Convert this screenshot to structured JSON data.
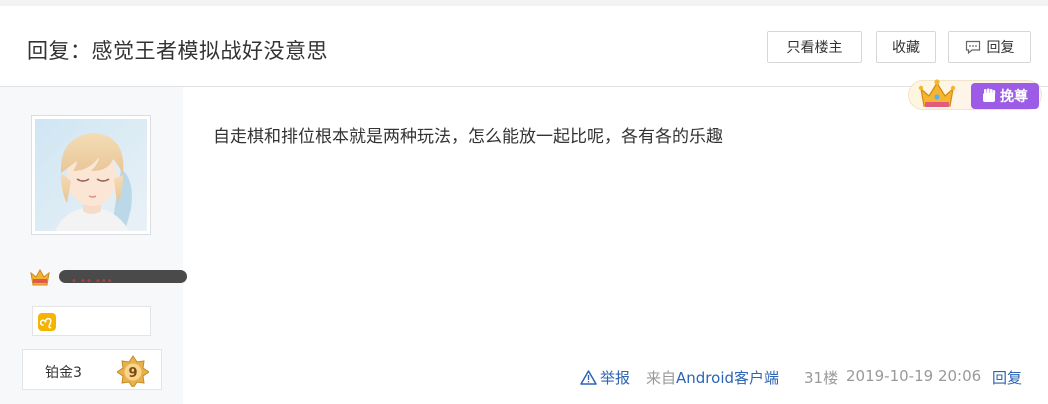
{
  "post": {
    "title": "回复：感觉王者模拟战好没意思",
    "content": "自走棋和排位根本就是两种玩法，怎么能放一起比呢，各有各的乐趣"
  },
  "header_buttons": {
    "only_op": "只看楼主",
    "favorite": "收藏",
    "reply": "回复"
  },
  "author": {
    "name_text": "• •• •••",
    "level_name": "铂金3",
    "level_number": "9",
    "sign_icon": "leo-zodiac-icon",
    "avatar": "anime-boy-avatar"
  },
  "vip": {
    "label": "挽尊",
    "icons": [
      "crown-icon",
      "fist-icon"
    ],
    "accent": "#9c5ce6"
  },
  "footer": {
    "report": "举报",
    "source_prefix": "来自",
    "source_link": "Android客户端",
    "floor": "31楼",
    "time": "2019-10-19 20:06",
    "reply": "回复"
  },
  "colors": {
    "link": "#2d64b3",
    "meta": "#999999",
    "sidebar_bg": "#f7f8fa"
  }
}
